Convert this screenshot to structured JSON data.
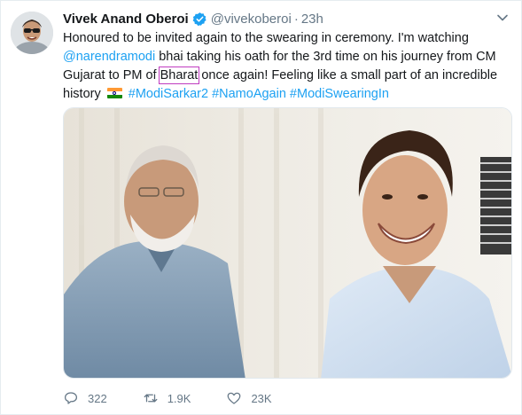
{
  "tweet": {
    "author_name": "Vivek Anand Oberoi",
    "handle": "@vivekoberoi",
    "separator": "·",
    "time": "23h",
    "text": {
      "l1": "Honoured to be invited again to the swearing in ceremony. I'm watching",
      "mention": "@narendramodi",
      "l2_rest": " bhai taking his oath for the 3rd time on his journey from CM",
      "l3_a": "Gujarat to PM of ",
      "l3_boxed": "Bharat",
      "l3_b": " once again! Feeling like a small part of an incredible",
      "l4_a": "history",
      "hashtags": "#ModiSarkar2 #NamoAgain #ModiSwearingIn"
    },
    "icons": {
      "verified": "verified-badge-icon",
      "caret": "chevron-down-icon",
      "flag": "india-flag-emoji"
    },
    "actions": {
      "reply_count": "322",
      "retweet_count": "1.9K",
      "like_count": "23K"
    },
    "colors": {
      "link": "#1da1f2",
      "text": "#14171a",
      "muted": "#657786",
      "highlight_box": "#c03cc0"
    }
  }
}
